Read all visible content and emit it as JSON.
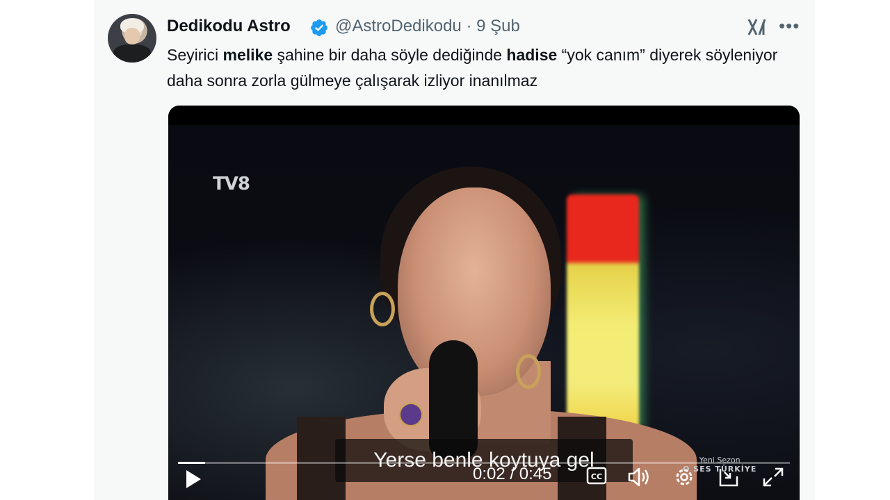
{
  "tweet": {
    "author_name": "Dedikodu Astro",
    "handle": "@AstroDedikodu",
    "separator": "·",
    "date": "9 Şub",
    "text_parts": [
      {
        "text": "Seyirici ",
        "bold": false
      },
      {
        "text": "melike",
        "bold": true
      },
      {
        "text": " şahine bir daha söyle dediğinde ",
        "bold": false
      },
      {
        "text": "hadise",
        "bold": true
      },
      {
        "text": " “yok canım” diyerek söyleniyor daha sonra zorla gülmeye çalışarak izliyor inanılmaz",
        "bold": false
      }
    ]
  },
  "video": {
    "channel_logo": "TV8",
    "watermark_line1": "Yeni Sezon",
    "watermark_line2": "O SES TÜRKİYE",
    "subtitle": "Yerse benle koytuya gel",
    "current_time": "0:02",
    "duration": "0:45",
    "time_display": "0:02 / 0:45",
    "progress_fraction": 0.044
  },
  "colors": {
    "text_primary": "#0f1419",
    "text_secondary": "#536471",
    "verified_blue": "#1d9bf0",
    "card_bg": "#f7f9f9"
  },
  "icons": [
    "verified-icon",
    "grok-icon",
    "more-icon",
    "play-icon",
    "captions-icon",
    "volume-icon",
    "settings-icon",
    "pip-icon",
    "fullscreen-icon"
  ]
}
